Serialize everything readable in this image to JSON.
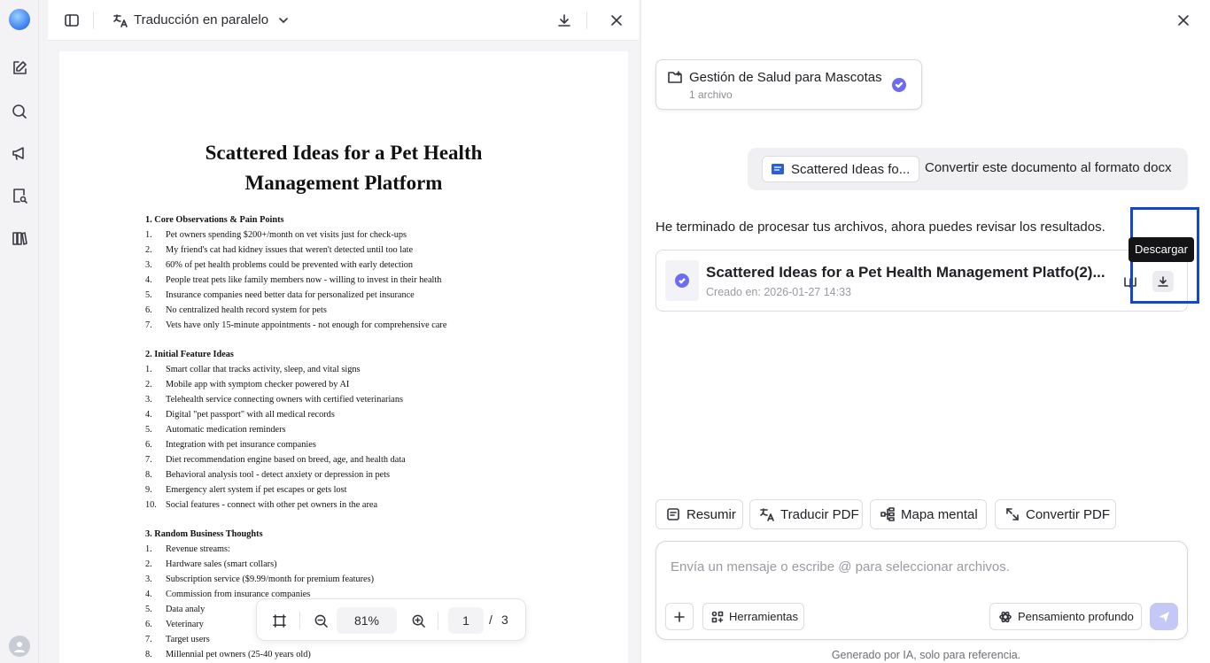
{
  "viewer": {
    "mode_title": "Traducción en paralelo",
    "document": {
      "title_line1": "Scattered Ideas for a Pet Health",
      "title_line2": "Management Platform",
      "sections": [
        {
          "heading": "1. Core Observations & Pain Points",
          "items": [
            {
              "n": "1.",
              "t": "Pet owners spending $200+/month on vet visits just for check-ups"
            },
            {
              "n": "2.",
              "t": "My friend's cat had kidney issues that weren't detected until too late"
            },
            {
              "n": "3.",
              "t": "60% of pet health problems could be prevented with early detection"
            },
            {
              "n": "4.",
              "t": "People treat pets like family members now - willing to invest in their health"
            },
            {
              "n": "5.",
              "t": "Insurance companies need better data for personalized pet insurance"
            },
            {
              "n": "6.",
              "t": "No centralized health record system for pets"
            },
            {
              "n": "7.",
              "t": "Vets have only 15-minute appointments - not enough for comprehensive care"
            }
          ]
        },
        {
          "heading": "2. Initial Feature Ideas",
          "items": [
            {
              "n": "1.",
              "t": "Smart collar that tracks activity, sleep, and vital signs"
            },
            {
              "n": "2.",
              "t": "Mobile app with symptom checker powered by AI"
            },
            {
              "n": "3.",
              "t": "Telehealth service connecting owners with certified veterinarians"
            },
            {
              "n": "4.",
              "t": "Digital \"pet passport\" with all medical records"
            },
            {
              "n": "5.",
              "t": "Automatic medication reminders"
            },
            {
              "n": "6.",
              "t": "Integration with pet insurance companies"
            },
            {
              "n": "7.",
              "t": "Diet recommendation engine based on breed, age, and health data"
            },
            {
              "n": "8.",
              "t": "Behavioral analysis tool - detect anxiety or depression in pets"
            },
            {
              "n": "9.",
              "t": "Emergency alert system if pet escapes or gets lost"
            },
            {
              "n": "10.",
              "t": "Social features - connect with other pet owners in the area"
            }
          ]
        },
        {
          "heading": "3. Random Business Thoughts",
          "items": [
            {
              "n": "1.",
              "t": "Revenue streams:"
            },
            {
              "n": "2.",
              "t": "Hardware sales (smart collars)"
            },
            {
              "n": "3.",
              "t": "Subscription service ($9.99/month for premium features)"
            },
            {
              "n": "4.",
              "t": "Commission from insurance companies"
            },
            {
              "n": "5.",
              "t": "Data analy"
            },
            {
              "n": "6.",
              "t": "Veterinary"
            },
            {
              "n": "7.",
              "t": "Target users"
            },
            {
              "n": "8.",
              "t": "Millennial pet owners (25-40 years old)"
            }
          ]
        }
      ]
    },
    "zoom": "81%",
    "page_current": "1",
    "page_separator": "/",
    "page_total": "3"
  },
  "chat": {
    "folder": {
      "name": "Gestión de Salud para Mascotas",
      "sub": "1 archivo"
    },
    "user_message": {
      "file_chip": "Scattered Ideas fo...",
      "text": "Convertir este documento al formato docx"
    },
    "ai_message": "He terminado de procesar tus archivos, ahora puedes revisar los resultados.",
    "result": {
      "title": "Scattered Ideas for a Pet Health Management Platfo(2)...",
      "date": "Creado en: 2026-01-27 14:33",
      "tooltip": "Descargar"
    },
    "quick_actions": [
      "Resumir",
      "Traducir PDF",
      "Mapa mental",
      "Convertir PDF"
    ],
    "composer": {
      "placeholder": "Envía un mensaje o escribe @ para seleccionar archivos.",
      "tools_label": "Herramientas",
      "deep_label": "Pensamiento profundo"
    },
    "footnote": "Generado por IA, solo para referencia."
  },
  "colors": {
    "accent": "#6c6cf0",
    "highlight": "#1248c9",
    "send_disabled": "#c5c7f7"
  }
}
